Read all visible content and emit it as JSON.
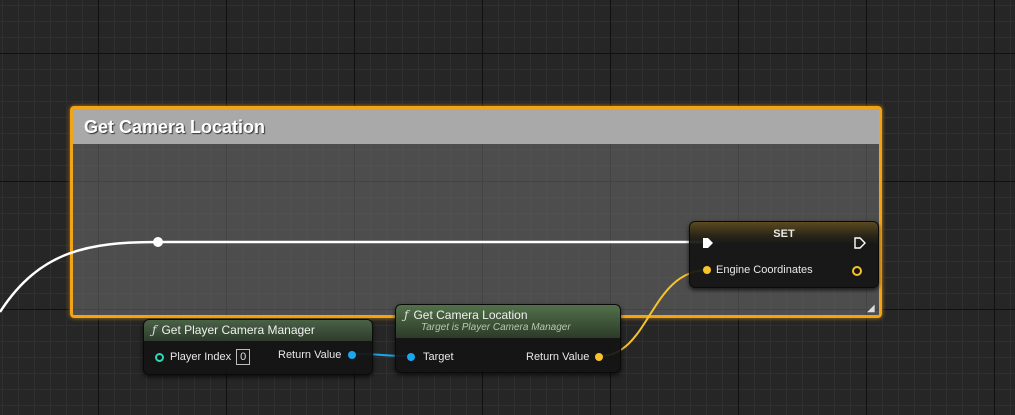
{
  "comment": {
    "title": "Get Camera Location"
  },
  "nodes": {
    "set": {
      "title": "SET",
      "variable_label": "Engine Coordinates"
    },
    "player_cam": {
      "title": "Get Player Camera Manager",
      "input_label": "Player Index",
      "input_value": "0",
      "output_label": "Return Value"
    },
    "camera_loc": {
      "title": "Get Camera Location",
      "subtitle": "Target is Player Camera Manager",
      "input_label": "Target",
      "output_label": "Return Value"
    }
  },
  "icons": {
    "function": "ƒ",
    "resize": "◢"
  },
  "colors": {
    "comment_border": "#f2a417",
    "object_pin": "#1aa7ec",
    "vector_pin": "#f7c22a",
    "int_pin": "#2ed9b4",
    "exec_wire": "#ffffff",
    "function_header": "#4f6a48"
  }
}
